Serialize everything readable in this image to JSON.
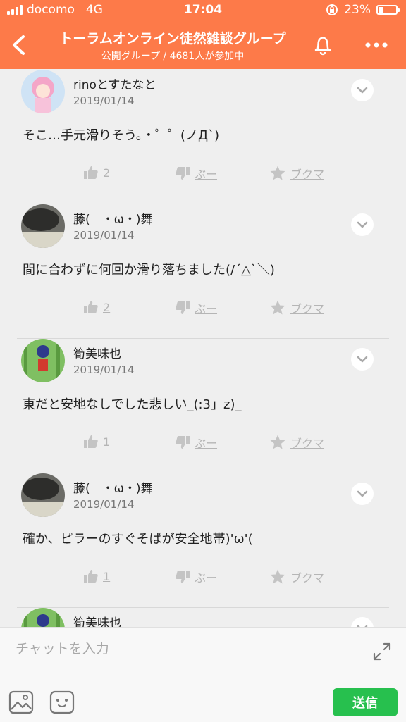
{
  "status_bar": {
    "carrier": "docomo",
    "network": "4G",
    "time": "17:04",
    "battery_percent": "23%",
    "battery_level": 0.23
  },
  "header": {
    "title": "トーラムオンライン徒然雑談グループ",
    "subtitle": "公開グループ / 4681人が参加中",
    "accent_color": "#fd7a49"
  },
  "posts": [
    {
      "author": "rinoとすたなと",
      "date": "2019/01/14",
      "message": "そこ…手元滑りそう。・゜゜(ノД`)",
      "likes": "2",
      "boo_label": "ぶー",
      "bookmark_label": "ブクマ"
    },
    {
      "author": "藤(　・ω・)舞",
      "date": "2019/01/14",
      "message": "間に合わずに何回か滑り落ちました(/´△`＼)",
      "likes": "2",
      "boo_label": "ぶー",
      "bookmark_label": "ブクマ"
    },
    {
      "author": "筍美味也",
      "date": "2019/01/14",
      "message": "東だと安地なしでした悲しい_(:3」z)_",
      "likes": "1",
      "boo_label": "ぶー",
      "bookmark_label": "ブクマ"
    },
    {
      "author": "藤(　・ω・)舞",
      "date": "2019/01/14",
      "message": "確か、ピラーのすぐそばが安全地帯)'ω'(",
      "likes": "1",
      "boo_label": "ぶー",
      "bookmark_label": "ブクマ"
    },
    {
      "author": "筍美味也"
    }
  ],
  "input_bar": {
    "placeholder": "チャットを入力",
    "send_label": "送信",
    "send_color": "#27c04e"
  },
  "icons": [
    "back-chevron-icon",
    "bell-icon",
    "more-dots-icon",
    "chevron-down-icon",
    "thumbs-up-icon",
    "thumbs-down-icon",
    "star-icon",
    "expand-icon",
    "image-icon",
    "sticker-icon"
  ]
}
